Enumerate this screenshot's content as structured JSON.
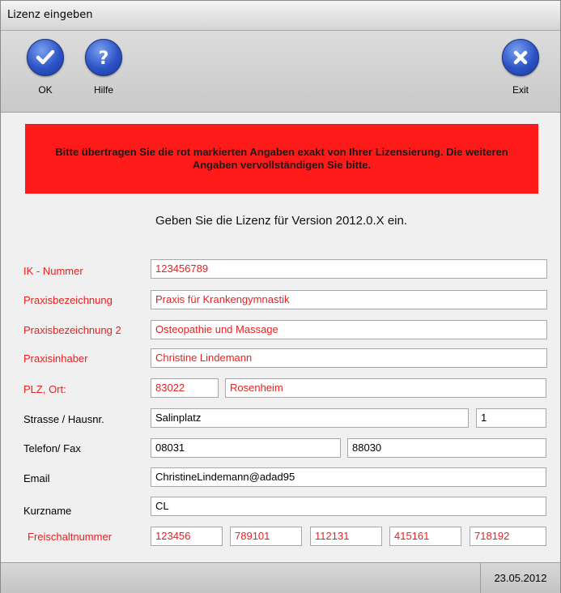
{
  "window": {
    "title": "Lizenz eingeben"
  },
  "toolbar": {
    "ok_label": "OK",
    "help_label": "Hilfe",
    "exit_label": "Exit",
    "ok_icon": "checkmark-icon",
    "help_icon": "question-icon",
    "exit_icon": "close-icon"
  },
  "banner": {
    "text": "Bitte übertragen Sie die rot markierten Angaben exakt von Ihrer Lizensierung. Die weiteren Angaben vervollständigen Sie bitte."
  },
  "headline": "Geben Sie die Lizenz für Version 2012.0.X ein.",
  "fields": {
    "ik_label": "IK - Nummer",
    "ik_value": "123456789",
    "praxis_label": "Praxisbezeichnung",
    "praxis_value": "Praxis für Krankengymnastik",
    "praxis2_label": "Praxisbezeichnung 2",
    "praxis2_value": "Osteopathie und Massage",
    "inhaber_label": "Praxisinhaber",
    "inhaber_value": "Christine Lindemann",
    "plz_label": "PLZ, Ort:",
    "plz_value": "83022",
    "ort_value": "Rosenheim",
    "strasse_label": "Strasse / Hausnr.",
    "strasse_value": "Salinplatz",
    "hausnr_value": "1",
    "telefon_label": "Telefon/ Fax",
    "telefon_value": "08031",
    "fax_value": "88030",
    "email_label": "Email",
    "email_value": "ChristineLindemann@adad95",
    "kurzname_label": "Kurzname",
    "kurzname_value": "CL",
    "freischalt_label": "Freischaltnummer",
    "freischalt_values": [
      "123456",
      "789101",
      "112131",
      "415161",
      "718192"
    ]
  },
  "colors": {
    "required": "#e82020",
    "banner": "#ff1a1a",
    "icon_blue": "#2c53c6"
  },
  "status": {
    "date": "23.05.2012"
  }
}
